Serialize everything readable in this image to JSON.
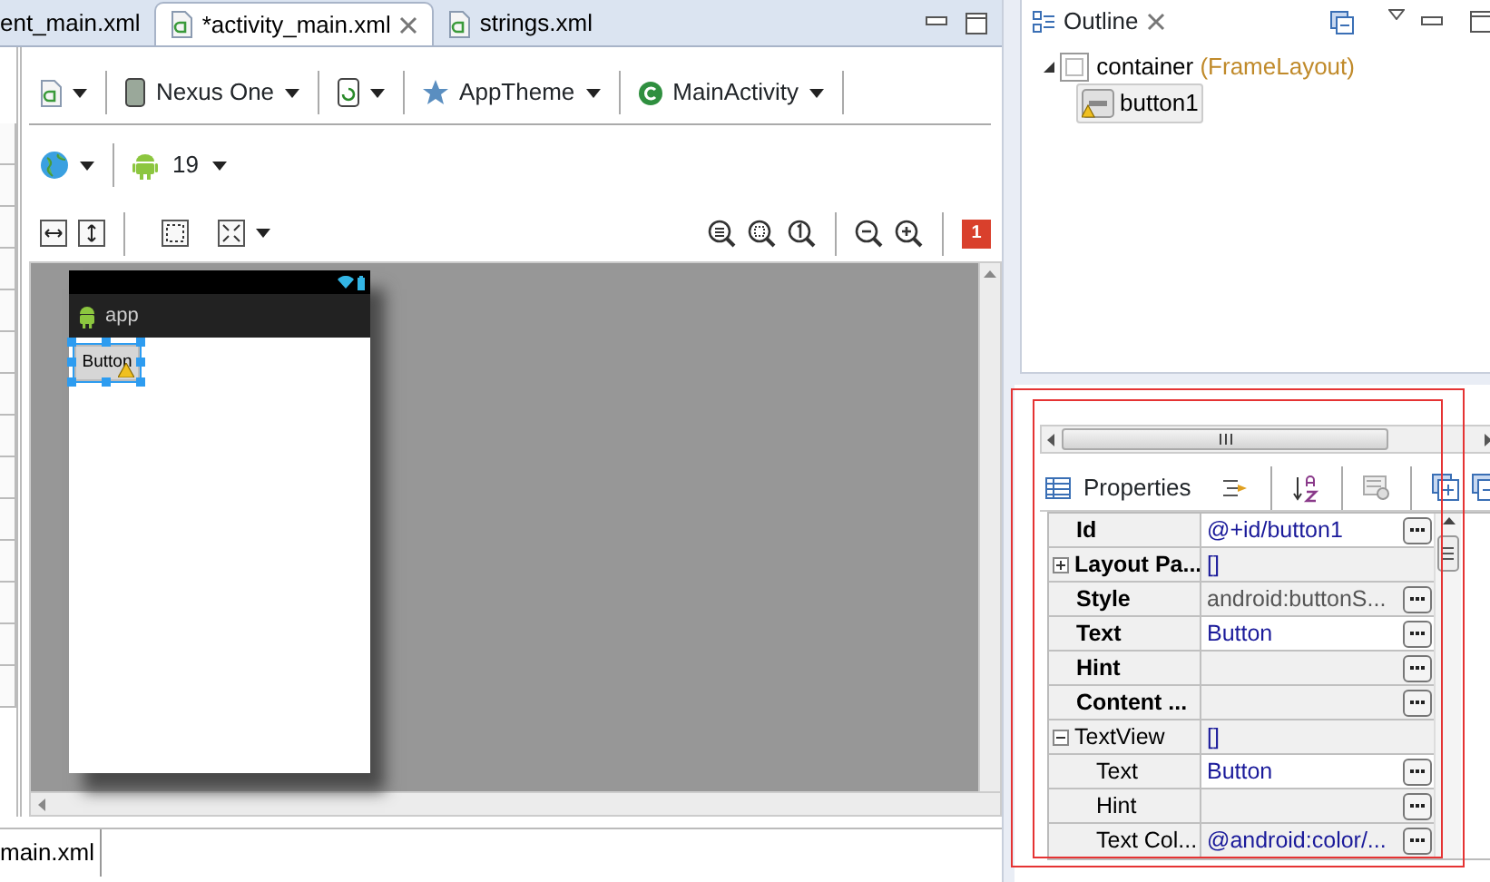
{
  "editor_tabs": [
    {
      "label": "ent_main.xml",
      "selected": false
    },
    {
      "label": "*activity_main.xml",
      "selected": true
    },
    {
      "label": "strings.xml",
      "selected": false
    }
  ],
  "toolbar": {
    "device": "Nexus One",
    "theme": "AppTheme",
    "activity": "MainActivity",
    "api_level": "19",
    "error_count": "1"
  },
  "preview": {
    "app_title": "app",
    "widget_label": "Button",
    "widget_selected": true,
    "widget_warning": true
  },
  "bottom_tabs": [
    {
      "label": "main.xml",
      "selected": true
    }
  ],
  "outline": {
    "title": "Outline",
    "tree": [
      {
        "label": "container",
        "detail": "(FrameLayout)",
        "expanded": true,
        "selected": false,
        "children": [
          {
            "label": "button1",
            "selected": true,
            "warning": true
          }
        ]
      }
    ]
  },
  "properties": {
    "title": "Properties",
    "rows": [
      {
        "name": "Id",
        "value": "@+id/button1",
        "bold": true,
        "modified": true,
        "default_value": false,
        "editor_button": true
      },
      {
        "name": "Layout Pa...",
        "value": "[]",
        "bold": true,
        "modified": false,
        "default_value": false,
        "editor_button": false,
        "expanded": false
      },
      {
        "name": "Style",
        "value": "android:buttonS...",
        "bold": true,
        "modified": false,
        "default_value": true,
        "editor_button": true
      },
      {
        "name": "Text",
        "value": "Button",
        "bold": true,
        "modified": true,
        "default_value": false,
        "editor_button": true
      },
      {
        "name": "Hint",
        "bold": true,
        "modified": false,
        "editor_button": true
      },
      {
        "name": "Content ...",
        "bold": true,
        "modified": false,
        "editor_button": true
      },
      {
        "name": "TextView",
        "value": "[]",
        "bold": false,
        "modified": false,
        "default_value": false,
        "editor_button": false,
        "expanded": true,
        "children": [
          {
            "name": "Text",
            "value": "Button",
            "bold": false,
            "modified": true,
            "default_value": false,
            "editor_button": true
          },
          {
            "name": "Hint",
            "bold": false,
            "modified": false,
            "editor_button": true
          },
          {
            "name": "Text Col...",
            "value": "@android:color/...",
            "bold": false,
            "modified": false,
            "default_value": false,
            "editor_button": true
          }
        ]
      }
    ]
  }
}
